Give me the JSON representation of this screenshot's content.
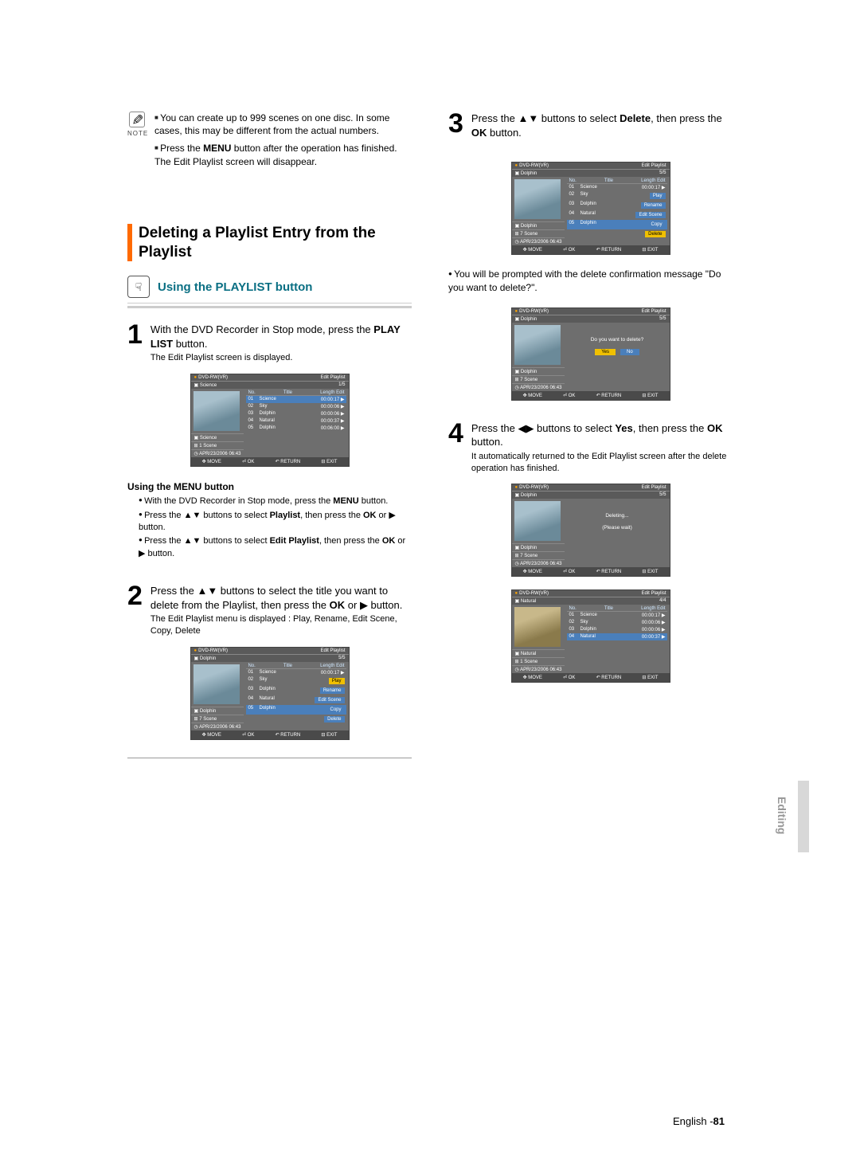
{
  "note": {
    "label": "NOTE",
    "item1": "You can create up to 999 scenes on one disc. In some cases, this may be different from the actual numbers.",
    "item2_a": "Press the ",
    "item2_b": "MENU",
    "item2_c": " button after the operation has finished. The Edit Playlist screen will disappear."
  },
  "section_title": "Deleting a Playlist Entry from the Playlist",
  "playlist_btn_title": "Using the PLAYLIST button",
  "step1": {
    "num": "1",
    "line_a": "With the DVD Recorder in Stop mode, press the ",
    "line_b": "PLAY LIST",
    "line_c": " button.",
    "sub": "The Edit Playlist screen is displayed."
  },
  "menu_head": "Using the MENU button",
  "menu_items": {
    "i1_a": "With the DVD Recorder in Stop mode, press the ",
    "i1_b": "MENU",
    "i1_c": " button.",
    "i2_a": "Press the ▲▼ buttons to select ",
    "i2_b": "Playlist",
    "i2_c": ", then press the ",
    "i2_d": "OK",
    "i2_e": " or ▶ button.",
    "i3_a": "Press the ▲▼ buttons to select ",
    "i3_b": "Edit Playlist",
    "i3_c": ", then press the ",
    "i3_d": "OK",
    "i3_e": " or ▶ button."
  },
  "step2": {
    "num": "2",
    "line_a": "Press the ▲▼ buttons to select the title you want to delete from the Playlist, then press the ",
    "line_b": "OK",
    "line_c": " or ▶ button.",
    "sub": "The Edit Playlist menu is displayed : Play, Rename, Edit Scene, Copy, Delete"
  },
  "step3": {
    "num": "3",
    "line_a": "Press the ▲▼ buttons to select ",
    "line_b": "Delete",
    "line_c": ", then press the ",
    "line_d": "OK",
    "line_e": " button."
  },
  "bullet3": "You will be prompted with the delete confirmation message \"Do you want to delete?\".",
  "step4": {
    "num": "4",
    "line_a": "Press the ◀▶ buttons to select ",
    "line_b": "Yes",
    "line_c": ", then press the ",
    "line_d": "OK",
    "line_e": " button.",
    "sub": "It automatically returned to the Edit Playlist screen after the delete operation has finished."
  },
  "ss_common": {
    "disc": "DVD-RW(VR)",
    "edit": "Edit Playlist",
    "move": "MOVE",
    "ok": "OK",
    "return": "RETURN",
    "exit": "EXIT",
    "no": "No.",
    "title": "Title",
    "length": "Length Edit"
  },
  "ss1": {
    "name": "Science",
    "count": "1/5",
    "rows": [
      {
        "n": "01",
        "t": "Science",
        "l": "00:00:17 ▶"
      },
      {
        "n": "02",
        "t": "Sky",
        "l": "00:00:06 ▶"
      },
      {
        "n": "03",
        "t": "Dolphin",
        "l": "00:00:06 ▶"
      },
      {
        "n": "04",
        "t": "Natural",
        "l": "00:00:37 ▶"
      },
      {
        "n": "05",
        "t": "Dolphin",
        "l": "00:06:00 ▶"
      }
    ],
    "sub_t": "Science",
    "sub_s": "1 Scene",
    "sub_d": "APR/23/2006 06:43"
  },
  "ss2": {
    "name": "Dolphin",
    "count": "5/5",
    "rows": [
      {
        "n": "01",
        "t": "Science",
        "l": "00:00:17 ▶"
      },
      {
        "n": "02",
        "t": "Sky"
      },
      {
        "n": "03",
        "t": "Dolphin"
      },
      {
        "n": "04",
        "t": "Natural"
      },
      {
        "n": "05",
        "t": "Dolphin"
      }
    ],
    "menu": [
      "Play",
      "Rename",
      "Edit Scene",
      "Copy",
      "Delete"
    ],
    "sub_t": "Dolphin",
    "sub_s": "7 Scene",
    "sub_d": "APR/23/2006 06:43"
  },
  "ss3": {
    "name": "Dolphin",
    "count": "5/5",
    "msg": "Do you want to delete?",
    "yes": "Yes",
    "no": "No",
    "sub_t": "Dolphin",
    "sub_s": "7 Scene",
    "sub_d": "APR/23/2006 06:43"
  },
  "ss4": {
    "name": "Dolphin",
    "count": "5/5",
    "msg1": "Deleting...",
    "msg2": "(Please wait)",
    "sub_t": "Dolphin",
    "sub_s": "7 Scene",
    "sub_d": "APR/23/2006 06:43"
  },
  "ss5": {
    "name": "Natural",
    "count": "4/4",
    "rows": [
      {
        "n": "01",
        "t": "Science",
        "l": "00:00:17 ▶"
      },
      {
        "n": "02",
        "t": "Sky",
        "l": "00:00:06 ▶"
      },
      {
        "n": "03",
        "t": "Dolphin",
        "l": "00:00:06 ▶"
      },
      {
        "n": "04",
        "t": "Natural",
        "l": "00:00:37 ▶"
      }
    ],
    "sub_t": "Natural",
    "sub_s": "1 Scene",
    "sub_d": "APR/23/2006 06:43"
  },
  "side_label": "Editing",
  "footer_a": "English -",
  "footer_b": "81"
}
